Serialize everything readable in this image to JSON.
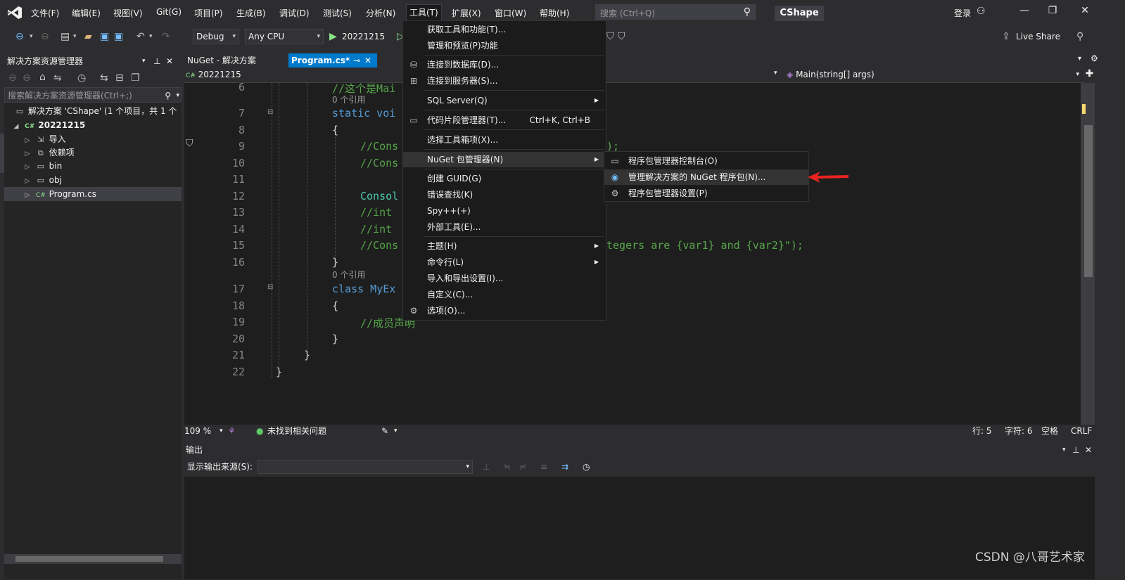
{
  "menubar": {
    "items": [
      "文件(F)",
      "编辑(E)",
      "视图(V)",
      "Git(G)",
      "项目(P)",
      "生成(B)",
      "调试(D)",
      "测试(S)",
      "分析(N)",
      "工具(T)",
      "扩展(X)",
      "窗口(W)",
      "帮助(H)"
    ],
    "search_placeholder": "搜索 (Ctrl+Q)",
    "app_title": "CShape",
    "login": "登录"
  },
  "toolbar": {
    "config": "Debug",
    "platform": "Any CPU",
    "start_target": "20221215",
    "live_share": "Live Share"
  },
  "solution_explorer": {
    "title": "解决方案资源管理器",
    "search_placeholder": "搜索解决方案资源管理器(Ctrl+;)",
    "tree": [
      {
        "label": "解决方案 'CShape' (1 个项目，共 1 个",
        "icon": "solution-icon"
      },
      {
        "label": "20221215",
        "icon": "csharp-project-icon"
      },
      {
        "label": "导入",
        "icon": "imports-icon"
      },
      {
        "label": "依赖项",
        "icon": "dependencies-icon"
      },
      {
        "label": "bin",
        "icon": "folder-icon"
      },
      {
        "label": "obj",
        "icon": "folder-icon"
      },
      {
        "label": "Program.cs",
        "icon": "csharp-file-icon"
      }
    ]
  },
  "editor": {
    "tabs": [
      "NuGet - 解决方案",
      "Program.cs*"
    ],
    "nav_project": "20221215",
    "nav_member": "Main(string[] args)",
    "zoom": "109 %",
    "issues": "未找到相关问题",
    "line": "行: 5",
    "char": "字符: 6",
    "spaces": "空格",
    "eol": "CRLF",
    "lens_refs": "0 个引用",
    "lines": [
      {
        "no": "6",
        "code": "//这个是Mai"
      },
      {
        "no": "7",
        "code": "static voi"
      },
      {
        "no": "8",
        "code": "{"
      },
      {
        "no": "9",
        "code": "//Cons",
        "tail": ");"
      },
      {
        "no": "10",
        "code": "//Cons"
      },
      {
        "no": "11",
        "code": ""
      },
      {
        "no": "12",
        "code": "Consol"
      },
      {
        "no": "13",
        "code": "//int"
      },
      {
        "no": "14",
        "code": "//int"
      },
      {
        "no": "15",
        "code": "//Cons",
        "tail": "tegers are {var1} and {var2}\");"
      },
      {
        "no": "16",
        "code": "}"
      },
      {
        "no": "17",
        "code": "class MyEx"
      },
      {
        "no": "18",
        "code": "{"
      },
      {
        "no": "19",
        "code": "//成员声明"
      },
      {
        "no": "20",
        "code": "}"
      },
      {
        "no": "21",
        "code": "}"
      },
      {
        "no": "22",
        "code": "}"
      }
    ]
  },
  "output": {
    "title": "输出",
    "source_label": "显示输出来源(S):"
  },
  "tools_menu": {
    "items": [
      {
        "label": "获取工具和功能(T)..."
      },
      {
        "label": "管理和预览(P)功能"
      },
      {
        "label": "连接到数据库(D)...",
        "icon": "database-icon"
      },
      {
        "label": "连接到服务器(S)...",
        "icon": "server-icon"
      },
      {
        "label": "SQL Server(Q)",
        "submenu": true
      },
      {
        "label": "代码片段管理器(T)...",
        "shortcut": "Ctrl+K, Ctrl+B",
        "icon": "snippet-icon"
      },
      {
        "label": "选择工具箱项(X)..."
      },
      {
        "label": "NuGet 包管理器(N)",
        "submenu": true
      },
      {
        "label": "创建 GUID(G)"
      },
      {
        "label": "错误查找(K)"
      },
      {
        "label": "Spy++(+)"
      },
      {
        "label": "外部工具(E)..."
      },
      {
        "label": "主题(H)",
        "submenu": true
      },
      {
        "label": "命令行(L)",
        "submenu": true
      },
      {
        "label": "导入和导出设置(I)..."
      },
      {
        "label": "自定义(C)..."
      },
      {
        "label": "选项(O)...",
        "icon": "gear-icon"
      }
    ]
  },
  "nuget_submenu": {
    "items": [
      {
        "label": "程序包管理器控制台(O)"
      },
      {
        "label": "管理解决方案的 NuGet 程序包(N)..."
      },
      {
        "label": "程序包管理器设置(P)"
      }
    ]
  },
  "watermark": "CSDN @八哥艺术家",
  "colors": {
    "accent": "#007acc",
    "annotation_arrow": "#e8231f"
  }
}
